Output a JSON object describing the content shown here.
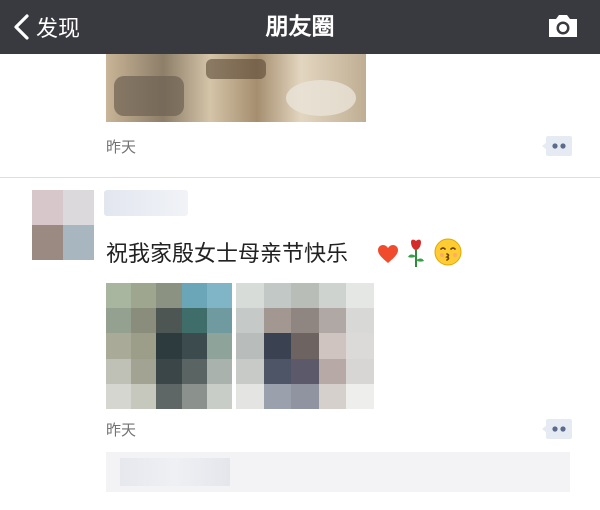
{
  "navbar": {
    "back_label": "发现",
    "title": "朋友圈",
    "back_icon": "chevron-left-icon",
    "camera_icon": "camera-icon"
  },
  "posts": [
    {
      "time": "昨天"
    },
    {
      "text": "祝我家殷女士母亲节快乐",
      "emojis": [
        "heart-icon",
        "rose-icon",
        "kissing-face-icon"
      ],
      "time": "昨天"
    }
  ],
  "colors": {
    "navbar_bg": "#393a3f",
    "comment_icon": "#5b6b8c",
    "time_text": "#737373"
  }
}
